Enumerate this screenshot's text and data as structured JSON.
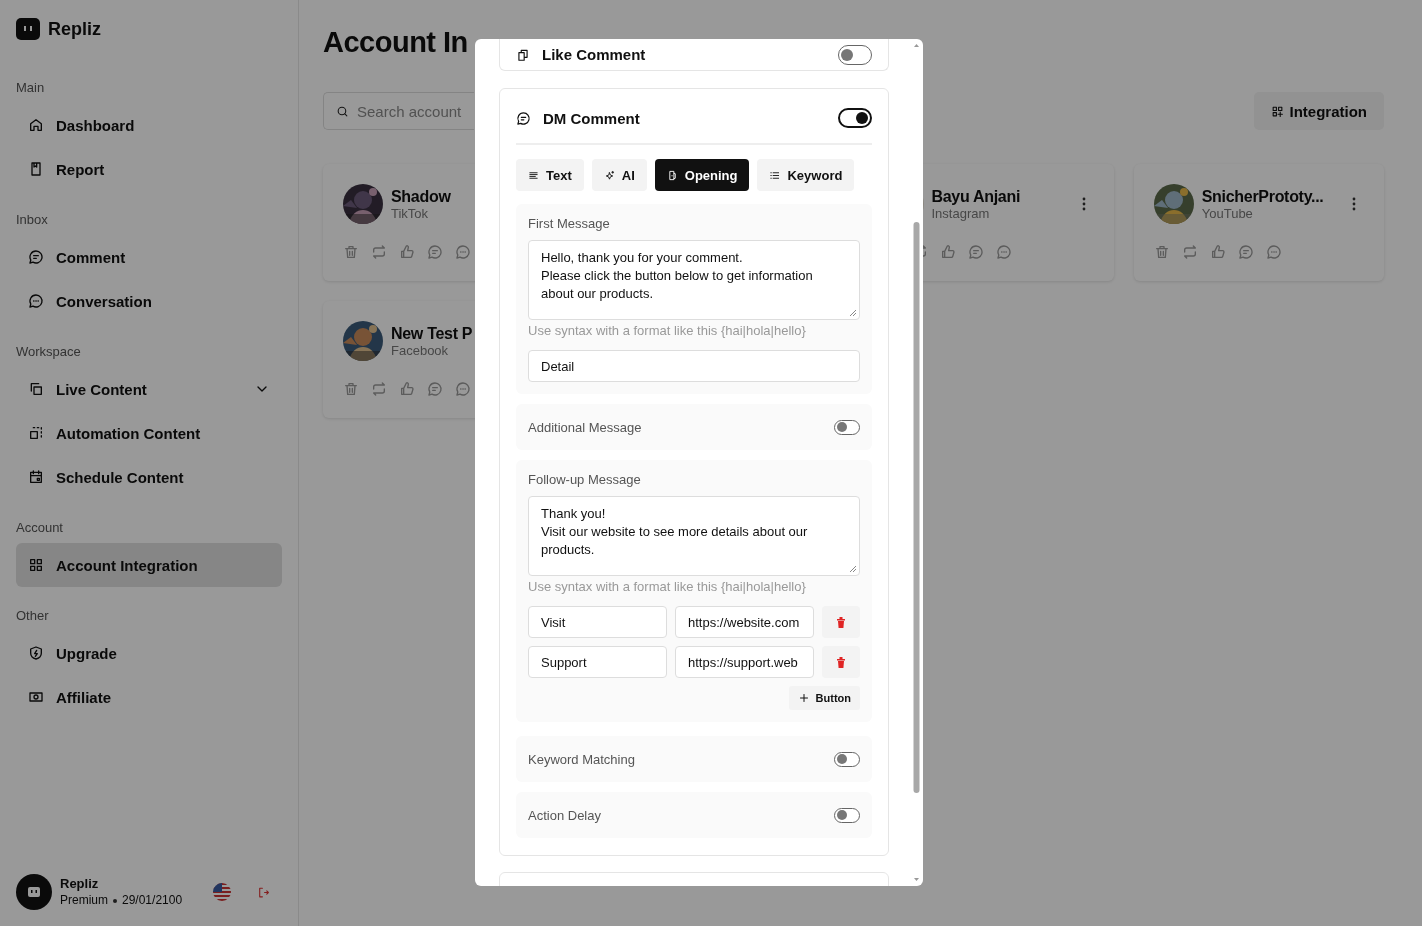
{
  "sidebar": {
    "brand": "Repliz",
    "sections": [
      {
        "title": "Main",
        "items": [
          {
            "label": "Dashboard",
            "kind": "link",
            "selected": false
          },
          {
            "label": "Report",
            "kind": "link",
            "selected": false
          }
        ]
      },
      {
        "title": "Inbox",
        "items": [
          {
            "label": "Comment",
            "kind": "link",
            "selected": false
          },
          {
            "label": "Conversation",
            "kind": "link",
            "selected": false
          }
        ]
      },
      {
        "title": "Workspace",
        "items": [
          {
            "label": "Live Content",
            "kind": "dropdown",
            "selected": false
          },
          {
            "label": "Automation Content",
            "kind": "link",
            "selected": false
          },
          {
            "label": "Schedule Content",
            "kind": "link",
            "selected": false
          }
        ]
      },
      {
        "title": "Account",
        "items": [
          {
            "label": "Account Integration",
            "kind": "link",
            "selected": true
          }
        ]
      },
      {
        "title": "Other",
        "items": [
          {
            "label": "Upgrade",
            "kind": "link",
            "selected": false
          },
          {
            "label": "Affiliate",
            "kind": "link",
            "selected": false
          }
        ]
      }
    ],
    "user": {
      "name": "Repliz",
      "plan": "Premium",
      "expiry": "29/01/2100"
    }
  },
  "page": {
    "title": "Account In",
    "search": {
      "placeholder": "Search account"
    },
    "integration_button": "Integration"
  },
  "accounts": [
    {
      "name": "Shadow",
      "platform": "TikTok"
    },
    {
      "name": "Bayu Anjani",
      "platform": "Instagram"
    },
    {
      "name": "SnicherPrototy...",
      "platform": "YouTube"
    },
    {
      "name": "New Test P",
      "platform": "Facebook"
    }
  ],
  "modal": {
    "like_comment": {
      "label": "Like Comment",
      "on": false
    },
    "dm_comment": {
      "label": "DM Comment",
      "on": true,
      "tabs": [
        {
          "label": "Text",
          "selected": false
        },
        {
          "label": "AI",
          "selected": false
        },
        {
          "label": "Opening",
          "selected": true
        },
        {
          "label": "Keyword",
          "selected": false
        }
      ],
      "first_message": {
        "label": "First Message",
        "value": "Hello, thank you for your comment.\nPlease click the button below to get information about our products.",
        "hint": "Use syntax with a format like this {hai|hola|hello}",
        "button_text": "Detail"
      },
      "additional_message": {
        "label": "Additional Message",
        "on": false
      },
      "follow_up": {
        "label": "Follow-up Message",
        "value": "Thank you!\nVisit our website to see more details about our products.",
        "hint": "Use syntax with a format like this {hai|hola|hello}",
        "buttons": [
          {
            "label": "Visit",
            "url": "https://website.com"
          },
          {
            "label": "Support",
            "url": "https://support.web"
          }
        ],
        "add_button": "Button"
      },
      "keyword_matching": {
        "label": "Keyword Matching",
        "on": false
      },
      "action_delay": {
        "label": "Action Delay",
        "on": false
      }
    }
  }
}
